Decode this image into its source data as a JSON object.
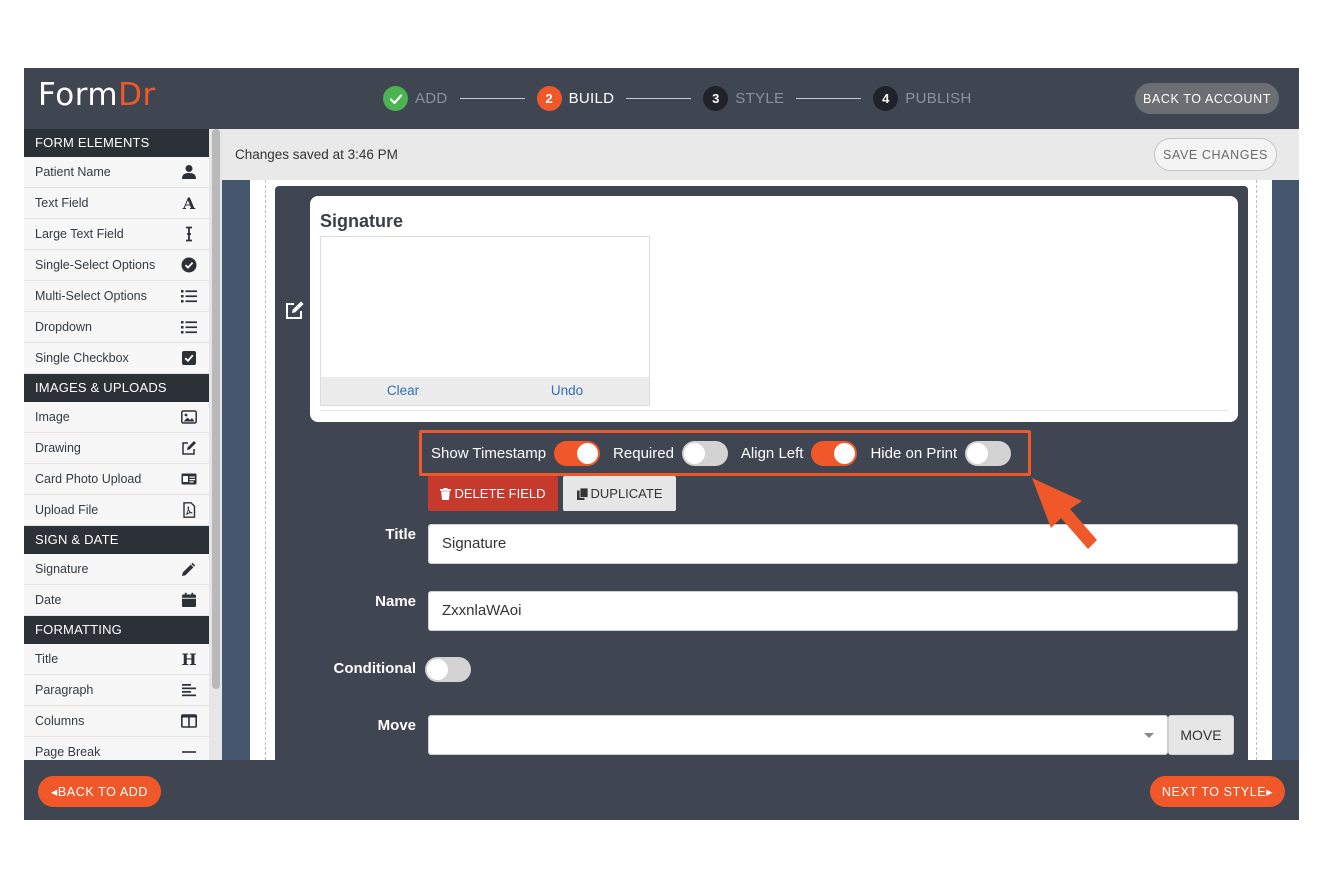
{
  "header": {
    "logo_form": "Form",
    "logo_dr": "Dr",
    "steps": [
      {
        "num": "✓",
        "label": "ADD",
        "state": "done"
      },
      {
        "num": "2",
        "label": "BUILD",
        "state": "active"
      },
      {
        "num": "3",
        "label": "STYLE",
        "state": "upcoming"
      },
      {
        "num": "4",
        "label": "PUBLISH",
        "state": "upcoming"
      }
    ],
    "back_account_label": "BACK TO ACCOUNT"
  },
  "sidebar": {
    "sections": [
      {
        "title": "FORM ELEMENTS",
        "items": [
          {
            "label": "Patient Name",
            "icon": "user-icon"
          },
          {
            "label": "Text Field",
            "icon": "font-icon"
          },
          {
            "label": "Large Text Field",
            "icon": "text-cursor-icon"
          },
          {
            "label": "Single-Select Options",
            "icon": "check-circle-icon"
          },
          {
            "label": "Multi-Select Options",
            "icon": "list-icon"
          },
          {
            "label": "Dropdown",
            "icon": "list-icon"
          },
          {
            "label": "Single Checkbox",
            "icon": "check-square-icon"
          }
        ]
      },
      {
        "title": "IMAGES & UPLOADS",
        "items": [
          {
            "label": "Image",
            "icon": "image-icon"
          },
          {
            "label": "Drawing",
            "icon": "edit-icon"
          },
          {
            "label": "Card Photo Upload",
            "icon": "id-card-icon"
          },
          {
            "label": "Upload File",
            "icon": "file-pdf-icon"
          }
        ]
      },
      {
        "title": "SIGN & DATE",
        "items": [
          {
            "label": "Signature",
            "icon": "pencil-icon"
          },
          {
            "label": "Date",
            "icon": "calendar-icon"
          }
        ]
      },
      {
        "title": "FORMATTING",
        "items": [
          {
            "label": "Title",
            "icon": "heading-icon"
          },
          {
            "label": "Paragraph",
            "icon": "align-left-icon"
          },
          {
            "label": "Columns",
            "icon": "columns-icon"
          },
          {
            "label": "Page Break",
            "icon": "page-break-icon"
          }
        ]
      }
    ]
  },
  "savebar": {
    "message": "Changes saved at 3:46 PM",
    "save_label": "SAVE CHANGES"
  },
  "field": {
    "card_title": "Signature",
    "clear_label": "Clear",
    "undo_label": "Undo",
    "toggles": [
      {
        "label": "Show Timestamp",
        "on": true
      },
      {
        "label": "Required",
        "on": false
      },
      {
        "label": "Align Left",
        "on": true
      },
      {
        "label": "Hide on Print",
        "on": false
      }
    ],
    "delete_label": "DELETE FIELD",
    "duplicate_label": "DUPLICATE",
    "title_label": "Title",
    "title_value": "Signature",
    "name_label": "Name",
    "name_value": "ZxxnlaWAoi",
    "conditional_label": "Conditional",
    "conditional_on": false,
    "move_label": "Move",
    "move_value": "",
    "move_button": "MOVE"
  },
  "footer": {
    "back_add_label": "BACK TO ADD",
    "next_style_label": "NEXT TO STYLE"
  },
  "colors": {
    "accent": "#f0582a",
    "dark": "#3f4652",
    "success": "#4bb34f"
  }
}
